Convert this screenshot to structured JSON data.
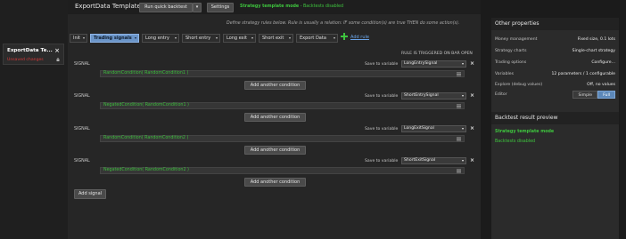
{
  "sidebar": {
    "tab_name": "ExportData Te...",
    "tab_status": "Unsaved changes"
  },
  "header": {
    "title": "ExportData Template",
    "run_label": "Run quick backtest",
    "settings_label": "Settings",
    "mode_label": "Strategy template mode",
    "mode_sep": " - ",
    "mode_status": "Backtests disabled"
  },
  "hint": "Define strategy rules below. Rule is usually a relation: IF some condition(s) are true THEN do some action(s).",
  "tabs": [
    {
      "label": "Init"
    },
    {
      "label": "Trading signals"
    },
    {
      "label": "Long entry"
    },
    {
      "label": "Short entry"
    },
    {
      "label": "Long exit"
    },
    {
      "label": "Short exit"
    },
    {
      "label": "Export Data"
    }
  ],
  "add_rule_label": "Add rule",
  "rule_trigger_label": "RULE IS TRIGGERED ON BAR OPEN",
  "signals": [
    {
      "label": "SIGNAL",
      "save_label": "Save to variable",
      "variable": "LongEntrySignal",
      "condition": "RandomCondition( RandomCondition1 )",
      "add_condition": "Add another condition"
    },
    {
      "label": "SIGNAL",
      "save_label": "Save to variable",
      "variable": "ShortEntrySignal",
      "condition": "NegatedCondition( RandomCondition1 )",
      "add_condition": "Add another condition"
    },
    {
      "label": "SIGNAL",
      "save_label": "Save to variable",
      "variable": "LongExitSignal",
      "condition": "RandomCondition( RandomCondition2 )",
      "add_condition": "Add another condition"
    },
    {
      "label": "SIGNAL",
      "save_label": "Save to variable",
      "variable": "ShortExitSignal",
      "condition": "NegatedCondition( RandomCondition2 )",
      "add_condition": "Add another condition"
    }
  ],
  "add_signal_label": "Add signal",
  "other_properties": {
    "heading": "Other properties",
    "rows": [
      {
        "key": "Money management",
        "value": "Fixed size, 0.1 lots"
      },
      {
        "key": "Strategy charts",
        "value": "Single-chart strategy"
      },
      {
        "key": "Trading options",
        "value": "Configure..."
      },
      {
        "key": "Variables",
        "value": "12 parameters / 1 configurable"
      },
      {
        "key": "Explore (debug values)",
        "value": "Off, no values"
      }
    ],
    "editor_key": "Editor",
    "editor_options": [
      "Simple",
      "Full"
    ],
    "editor_selected": "Full"
  },
  "backtest_preview": {
    "heading": "Backtest result preview",
    "line1": "Strategy template mode",
    "line2": "Backtests disabled"
  },
  "colors": {
    "accent_blue": "#6b95c8",
    "green_text": "#3ec43e",
    "red_text": "#d83a3a"
  }
}
